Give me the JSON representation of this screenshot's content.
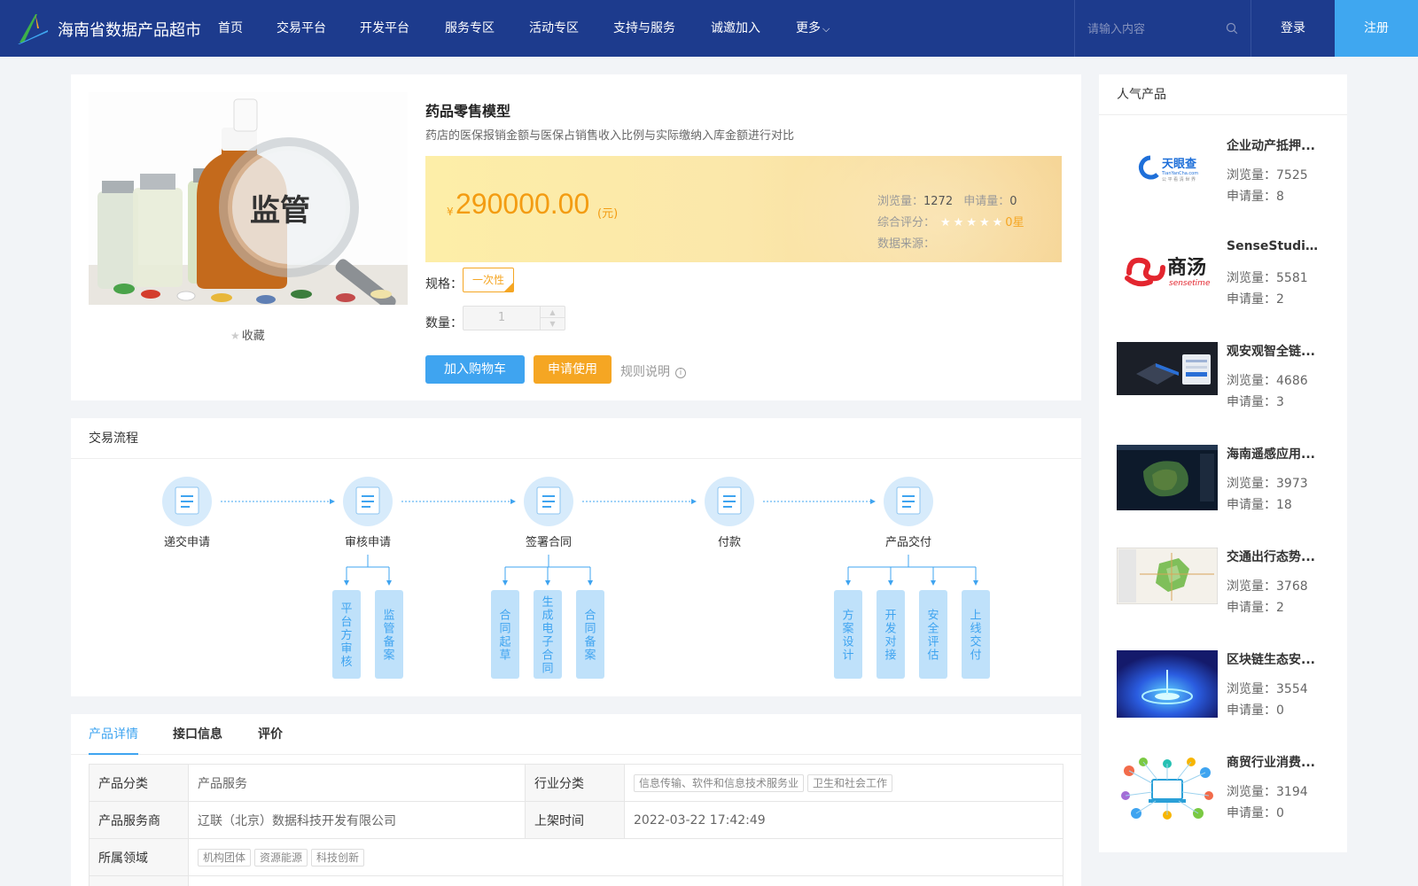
{
  "header": {
    "brand": "海南省数据产品超市",
    "nav": [
      "首页",
      "交易平台",
      "开发平台",
      "服务专区",
      "活动专区",
      "支持与服务",
      "诚邀加入",
      "更多"
    ],
    "search_placeholder": "请输入内容",
    "login": "登录",
    "register": "注册",
    "colors": {
      "bar": "#1d3b8d",
      "register": "#3fa7f0"
    }
  },
  "product": {
    "image_text": "监管",
    "favorite": "收藏",
    "title": "药品零售模型",
    "description": "药店的医保报销金额与医保占销售收入比例与实际缴纳入库金额进行对比",
    "currency": "¥",
    "price": "290000.00",
    "unit": "(元)",
    "views_label": "浏览量：",
    "views": "1272",
    "applications_label": "申请量：",
    "applications": "0",
    "rating_label": "综合评分：",
    "rating_stars": "★★★★★",
    "rating_value": 0,
    "rating_text": "0星",
    "source_label": "数据来源：",
    "spec_label": "规格：",
    "spec_option": "一次性",
    "quantity_label": "数量：",
    "quantity": "1",
    "add_cart": "加入购物车",
    "apply": "申请使用",
    "rules": "规则说明",
    "colors": {
      "price": "#f39c12",
      "primary": "#3fa4f0",
      "accent": "#f5a623"
    }
  },
  "process": {
    "title": "交易流程",
    "steps": [
      "递交申请",
      "审核申请",
      "签署合同",
      "付款",
      "产品交付"
    ],
    "review_substeps": [
      "平台方审核",
      "监管备案"
    ],
    "contract_substeps": [
      "合同起草",
      "生成电子合同",
      "合同备案"
    ],
    "delivery_substeps": [
      "方案设计",
      "开发对接",
      "安全评估",
      "上线交付"
    ]
  },
  "details": {
    "tabs": [
      "产品详情",
      "接口信息",
      "评价"
    ],
    "rows": {
      "category_label": "产品分类",
      "category": "产品服务",
      "industry_label": "行业分类",
      "industry_tags": [
        "信息传输、软件和信息技术服务业",
        "卫生和社会工作"
      ],
      "provider_label": "产品服务商",
      "provider": "辽联（北京）数据科技开发有限公司",
      "listed_label": "上架时间",
      "listed": "2022-03-22 17:42:49",
      "domain_label": "所属领域",
      "domain_tags": [
        "机构团体",
        "资源能源",
        "科技创新"
      ]
    }
  },
  "sidebar": {
    "title": "人气产品",
    "views_label": "浏览量：",
    "apps_label": "申请量：",
    "items": [
      {
        "name": "企业动产抵押...",
        "views": "7525",
        "apps": "8",
        "logo": "天眼查",
        "logo_sub": "TianYanCha.com",
        "logo_tag": "公 平 看 清 世 界"
      },
      {
        "name": "SenseStudio...",
        "views": "5581",
        "apps": "2",
        "logo": "商汤",
        "logo_sub": "sensetime"
      },
      {
        "name": "观安观智全链...",
        "views": "4686",
        "apps": "3"
      },
      {
        "name": "海南遥感应用...",
        "views": "3973",
        "apps": "18"
      },
      {
        "name": "交通出行态势...",
        "views": "3768",
        "apps": "2"
      },
      {
        "name": "区块链生态安...",
        "views": "3554",
        "apps": "0"
      },
      {
        "name": "商贸行业消费...",
        "views": "3194",
        "apps": "0"
      }
    ]
  }
}
